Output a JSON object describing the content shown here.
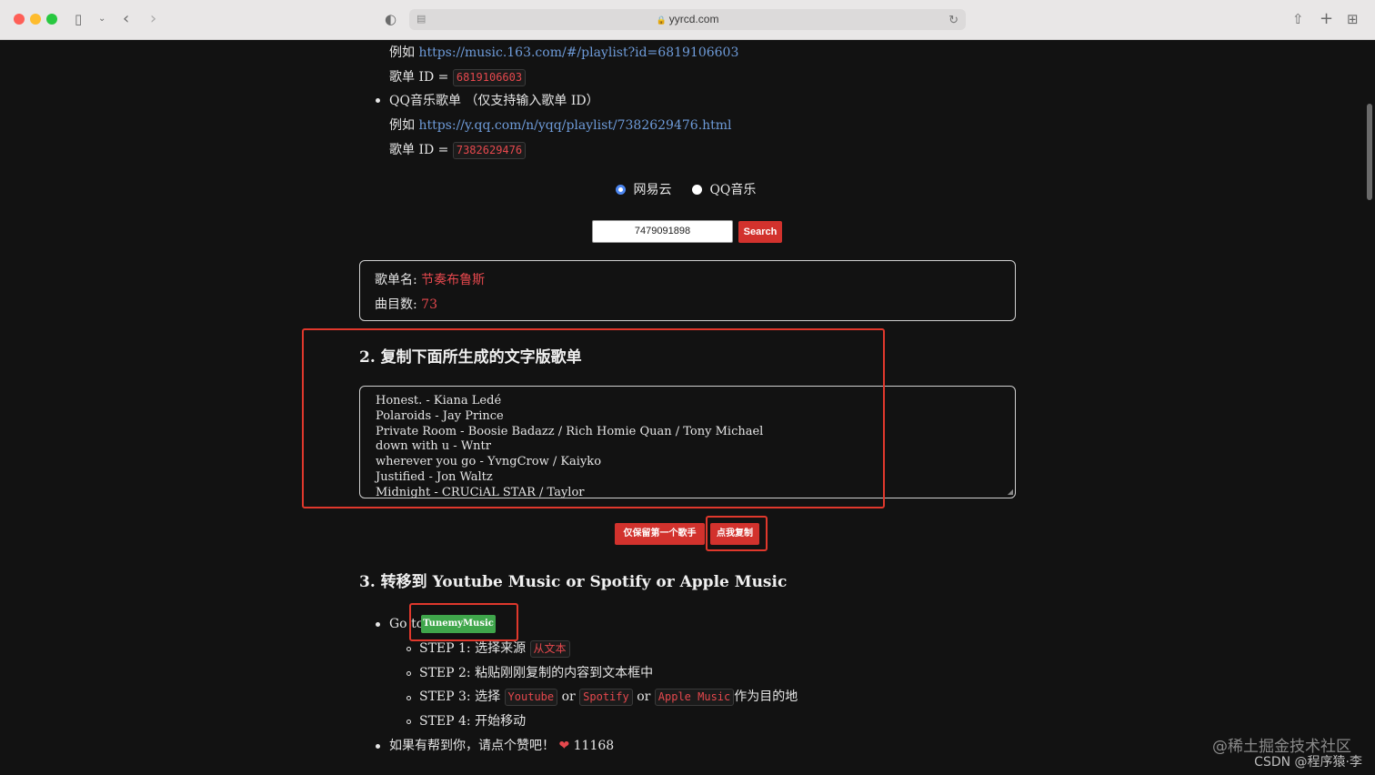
{
  "browser": {
    "url": "yyrcd.com",
    "icons": {
      "sidebar": "sidebar-icon",
      "back": "chevron-left-icon",
      "forward": "chevron-right-icon",
      "shield": "shield-icon",
      "share": "share-icon",
      "new_tab": "plus-icon",
      "tabs": "tab-overview-icon"
    }
  },
  "netease": {
    "example_prefix": "例如",
    "example_url": "https://music.163.com/#/playlist?id=6819106603",
    "id_label": "歌单 ID =",
    "id_value": "6819106603"
  },
  "qq": {
    "bullet_text": "QQ音乐歌单 （仅支持输入歌单 ID）",
    "example_prefix": "例如",
    "example_url": "https://y.qq.com/n/yqq/playlist/7382629476.html",
    "id_label": "歌单 ID =",
    "id_value": "7382629476"
  },
  "source_radio": {
    "options": [
      "网易云",
      "QQ音乐"
    ],
    "selected": "网易云"
  },
  "search": {
    "value": "7479091898",
    "button": "Search"
  },
  "playlist_info": {
    "name_label": "歌单名:",
    "name_value": "节奏布鲁斯",
    "count_label": "曲目数:",
    "count_value": "73"
  },
  "section2": {
    "heading": "2. 复制下面所生成的文字版歌单",
    "songs": [
      "Honest. - Kiana Ledé",
      "Polaroids - Jay Prince",
      "Private Room - Boosie Badazz / Rich Homie Quan / Tony Michael",
      "down with u - Wntr",
      "wherever you go - YvngCrow / Kaiyko",
      "Justified - Jon Waltz",
      "Midnight  - CRUCiAL STAR / Taylor"
    ],
    "keep_first_button": "仅保留第一个歌手",
    "copy_button": "点我复制"
  },
  "section3": {
    "heading": "3. 转移到 Youtube Music or Spotify or Apple Music",
    "goto_prefix": "Go to",
    "goto_button": "TunemyMusic",
    "step1_text": "STEP 1: 选择来源",
    "step1_code": "从文本",
    "step2_text": "STEP 2: 粘贴刚刚复制的内容到文本框中",
    "step3_text": "STEP 3: 选择",
    "step3_code1": "Youtube",
    "or1": "or",
    "step3_code2": "Spotify",
    "or2": "or",
    "step3_code3": "Apple Music",
    "step3_suffix": "作为目的地",
    "step4_text": "STEP 4: 开始移动",
    "like_text": "如果有帮到你，请点个赞吧！",
    "like_icon": "heart-icon",
    "like_count": "11168"
  },
  "watermarks": {
    "line1": "@稀土掘金技术社区",
    "line2": "CSDN @程序猿·李"
  },
  "colors": {
    "accent_red": "#d2322d",
    "code_red": "#e5484d",
    "link_blue": "#6e9bd9",
    "tunemy_green": "#3fa64b",
    "highlight_border": "#e0382c"
  }
}
